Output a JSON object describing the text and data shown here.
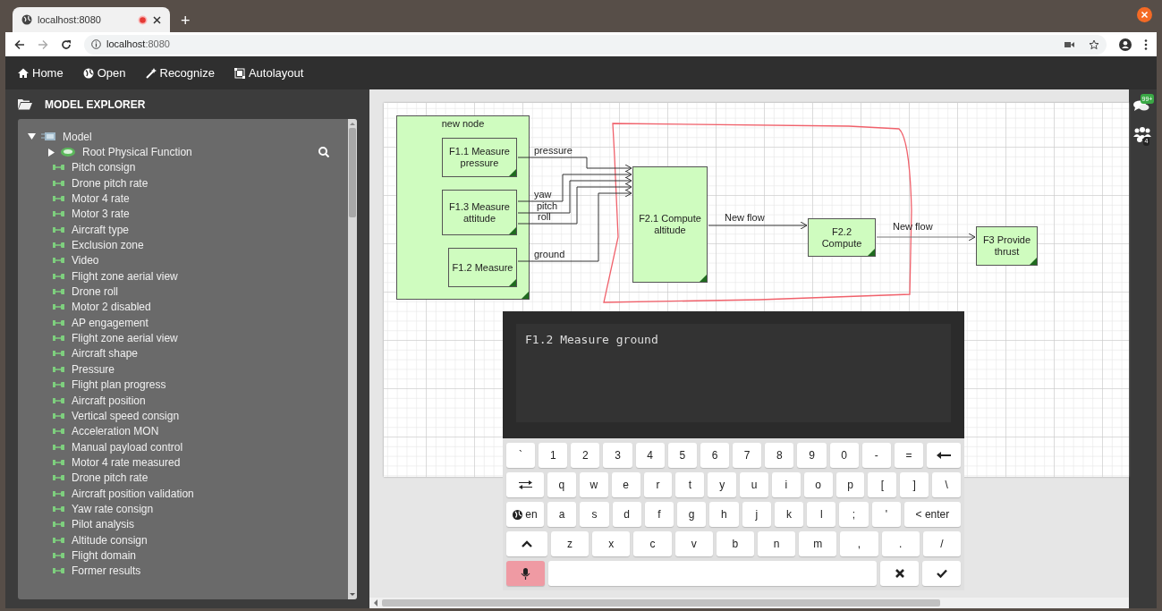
{
  "browser": {
    "tab_title": "localhost:8080",
    "new_tab": "+",
    "url_host": "localhost",
    "url_port": ":8080"
  },
  "toolbar": [
    {
      "kind": "home",
      "label": "Home"
    },
    {
      "kind": "open",
      "label": "Open"
    },
    {
      "kind": "recognize",
      "label": "Recognize"
    },
    {
      "kind": "autolayout",
      "label": "Autolayout"
    }
  ],
  "explorer": {
    "title": "MODEL EXPLORER",
    "tree": [
      {
        "kind": "model",
        "label": "Model",
        "expanded": true,
        "children": [
          {
            "kind": "function",
            "label": "Root Physical Function",
            "expanded": false
          },
          {
            "kind": "flow",
            "label": "Pitch consign"
          },
          {
            "kind": "flow",
            "label": "Drone pitch rate"
          },
          {
            "kind": "flow",
            "label": "Motor 4 rate"
          },
          {
            "kind": "flow",
            "label": "Motor 3 rate"
          },
          {
            "kind": "flow",
            "label": "Aircraft type"
          },
          {
            "kind": "flow",
            "label": "Exclusion zone"
          },
          {
            "kind": "flow",
            "label": "Video"
          },
          {
            "kind": "flow",
            "label": "Flight zone aerial view"
          },
          {
            "kind": "flow",
            "label": "Drone roll"
          },
          {
            "kind": "flow",
            "label": "Motor 2 disabled"
          },
          {
            "kind": "flow",
            "label": "AP engagement"
          },
          {
            "kind": "flow",
            "label": "Flight zone aerial view"
          },
          {
            "kind": "flow",
            "label": "Aircraft shape"
          },
          {
            "kind": "flow",
            "label": "Pressure"
          },
          {
            "kind": "flow",
            "label": "Flight plan progress"
          },
          {
            "kind": "flow",
            "label": "Aircraft position"
          },
          {
            "kind": "flow",
            "label": "Vertical speed consign"
          },
          {
            "kind": "flow",
            "label": "Acceleration MON"
          },
          {
            "kind": "flow",
            "label": "Manual payload control"
          },
          {
            "kind": "flow",
            "label": "Motor 4 rate measured"
          },
          {
            "kind": "flow",
            "label": "Drone pitch rate"
          },
          {
            "kind": "flow",
            "label": "Aircraft position validation"
          },
          {
            "kind": "flow",
            "label": "Yaw rate consign"
          },
          {
            "kind": "flow",
            "label": "Pilot analysis"
          },
          {
            "kind": "flow",
            "label": "Altitude consign"
          },
          {
            "kind": "flow",
            "label": "Flight domain"
          },
          {
            "kind": "flow",
            "label": "Former results"
          }
        ]
      }
    ]
  },
  "diagram": {
    "nodes": [
      {
        "kind": "group",
        "label": "new node"
      },
      {
        "kind": "function",
        "label": "F1.1 Measure pressure"
      },
      {
        "kind": "function",
        "label": "F1.3 Measure attitude"
      },
      {
        "kind": "function",
        "label": "F1.2 Measure"
      },
      {
        "kind": "function",
        "label": "F2.1 Compute altitude"
      },
      {
        "kind": "function",
        "label": "F2.2 Compute"
      },
      {
        "kind": "function",
        "label": "F3 Provide thrust"
      }
    ],
    "edges": [
      {
        "label": "pressure"
      },
      {
        "label": "yaw"
      },
      {
        "label": "pitch"
      },
      {
        "label": "roll"
      },
      {
        "label": "ground"
      },
      {
        "label": "New flow"
      },
      {
        "label": "New flow"
      }
    ]
  },
  "keyboard": {
    "text": "F1.2 Measure ground",
    "rows": [
      {
        "keys": [
          {
            "kind": "char",
            "label": "`"
          },
          {
            "kind": "char",
            "label": "1"
          },
          {
            "kind": "char",
            "label": "2"
          },
          {
            "kind": "char",
            "label": "3"
          },
          {
            "kind": "char",
            "label": "4"
          },
          {
            "kind": "char",
            "label": "5"
          },
          {
            "kind": "char",
            "label": "6"
          },
          {
            "kind": "char",
            "label": "7"
          },
          {
            "kind": "char",
            "label": "8"
          },
          {
            "kind": "char",
            "label": "9"
          },
          {
            "kind": "char",
            "label": "0"
          },
          {
            "kind": "char",
            "label": "-"
          },
          {
            "kind": "char",
            "label": "="
          },
          {
            "kind": "backspace"
          }
        ]
      },
      {
        "keys": [
          {
            "kind": "tab"
          },
          {
            "kind": "char",
            "label": "q"
          },
          {
            "kind": "char",
            "label": "w"
          },
          {
            "kind": "char",
            "label": "e"
          },
          {
            "kind": "char",
            "label": "r"
          },
          {
            "kind": "char",
            "label": "t"
          },
          {
            "kind": "char",
            "label": "y"
          },
          {
            "kind": "char",
            "label": "u"
          },
          {
            "kind": "char",
            "label": "i"
          },
          {
            "kind": "char",
            "label": "o"
          },
          {
            "kind": "char",
            "label": "p"
          },
          {
            "kind": "char",
            "label": "["
          },
          {
            "kind": "char",
            "label": "]"
          },
          {
            "kind": "char",
            "label": "\\"
          }
        ]
      },
      {
        "keys": [
          {
            "kind": "language",
            "label": "en"
          },
          {
            "kind": "char",
            "label": "a"
          },
          {
            "kind": "char",
            "label": "s"
          },
          {
            "kind": "char",
            "label": "d"
          },
          {
            "kind": "char",
            "label": "f"
          },
          {
            "kind": "char",
            "label": "g"
          },
          {
            "kind": "char",
            "label": "h"
          },
          {
            "kind": "char",
            "label": "j"
          },
          {
            "kind": "char",
            "label": "k"
          },
          {
            "kind": "char",
            "label": "l"
          },
          {
            "kind": "char",
            "label": ";"
          },
          {
            "kind": "char",
            "label": "'"
          },
          {
            "kind": "enter",
            "label": "< enter"
          }
        ]
      },
      {
        "keys": [
          {
            "kind": "shift"
          },
          {
            "kind": "char",
            "label": "z"
          },
          {
            "kind": "char",
            "label": "x"
          },
          {
            "kind": "char",
            "label": "c"
          },
          {
            "kind": "char",
            "label": "v"
          },
          {
            "kind": "char",
            "label": "b"
          },
          {
            "kind": "char",
            "label": "n"
          },
          {
            "kind": "char",
            "label": "m"
          },
          {
            "kind": "char",
            "label": ","
          },
          {
            "kind": "char",
            "label": "."
          },
          {
            "kind": "char",
            "label": "/"
          }
        ]
      },
      {
        "keys": [
          {
            "kind": "mic",
            "selected": true
          },
          {
            "kind": "space"
          },
          {
            "kind": "cancel"
          },
          {
            "kind": "ok"
          }
        ]
      }
    ]
  },
  "rail": {
    "chat_badge": "99+",
    "people_badge": "4"
  }
}
